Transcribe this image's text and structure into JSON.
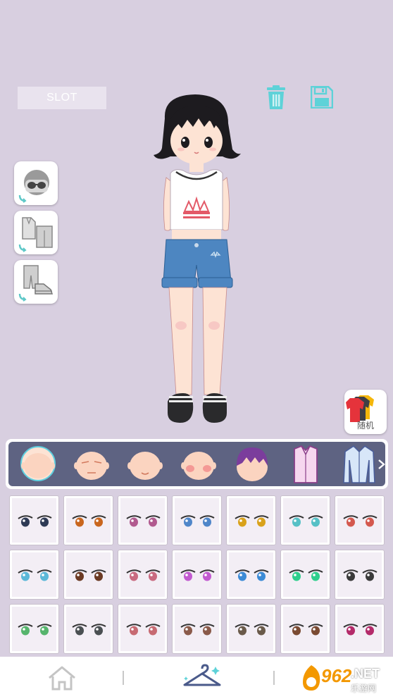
{
  "slot_label": "SLOT",
  "random_label": "随机",
  "colors": {
    "background": "#d8cfe0",
    "category_bar": "#5e6382",
    "accent_teal": "#5ed2d8",
    "skin": "#fde3d4"
  },
  "top_icons": [
    "trash-icon",
    "save-icon"
  ],
  "side_buttons": [
    {
      "name": "accessory-toggle-button",
      "icon": "sunglasses-icon"
    },
    {
      "name": "outfit-toggle-button",
      "icon": "shirt-pants-icon"
    },
    {
      "name": "shoes-toggle-button",
      "icon": "pants-shoes-icon"
    }
  ],
  "categories": [
    {
      "name": "face-plain",
      "selected": true
    },
    {
      "name": "face-closed-eyes",
      "selected": false
    },
    {
      "name": "face-smile",
      "selected": false
    },
    {
      "name": "face-blush",
      "selected": false
    },
    {
      "name": "hair",
      "selected": false
    },
    {
      "name": "top",
      "selected": false
    },
    {
      "name": "jacket",
      "selected": false
    }
  ],
  "eye_rows": 3,
  "eye_cols": 7,
  "eye_colors": [
    [
      "#2e3a55",
      "#c9661e",
      "#b15a8f",
      "#4f86c9",
      "#d9a21b",
      "#56c0c6",
      "#d4584e"
    ],
    [
      "#5bb8d8",
      "#6b3a23",
      "#c96a80",
      "#c25ad0",
      "#3c8bd6",
      "#2fcf8d",
      "#3a3a3a"
    ],
    [
      "#56b46c",
      "#4a4f52",
      "#c76a72",
      "#8a5a4a",
      "#6a5a4a",
      "#7a4a32",
      "#b42a6a"
    ]
  ],
  "nav_items": [
    "home-icon",
    "wardrobe-icon",
    "more-icon"
  ],
  "watermark": {
    "number": "962",
    "domain": ".NET",
    "site": "乐游网"
  }
}
